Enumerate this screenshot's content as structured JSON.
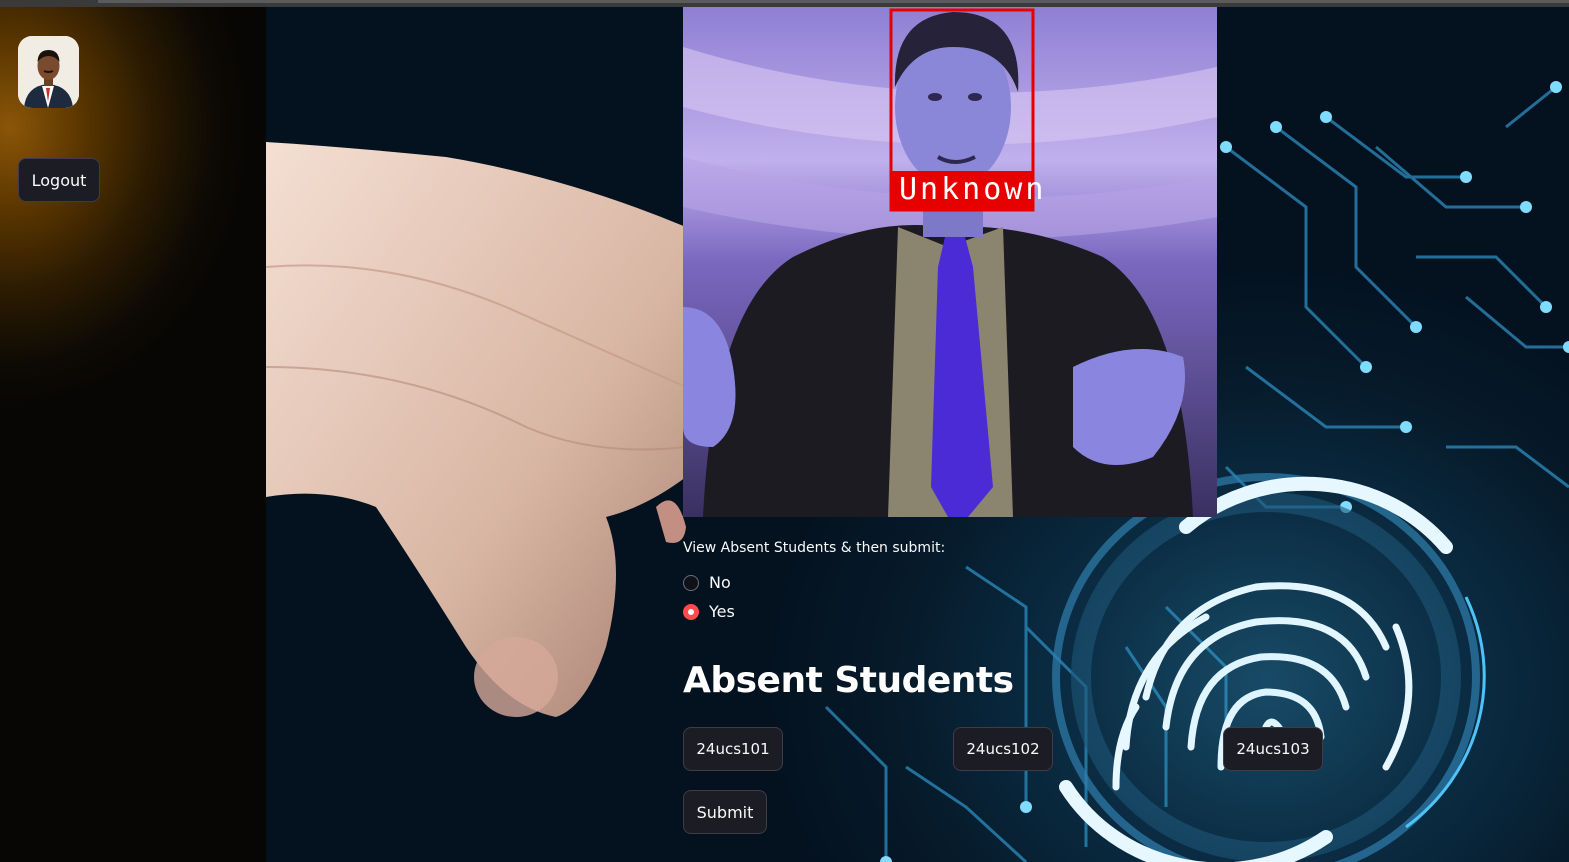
{
  "sidebar": {
    "avatar_icon": "user-avatar-icon",
    "logout_label": "Logout"
  },
  "photo": {
    "detection_label": "Unknown",
    "box_color": "#e60000"
  },
  "attendance": {
    "prompt": "View Absent Students & then submit:",
    "options": [
      {
        "label": "No",
        "selected": false
      },
      {
        "label": "Yes",
        "selected": true
      }
    ],
    "accent_color": "#ff4b4b"
  },
  "absent": {
    "heading": "Absent Students",
    "students": [
      "24ucs101",
      "24ucs102",
      "24ucs103"
    ],
    "submit_label": "Submit"
  }
}
